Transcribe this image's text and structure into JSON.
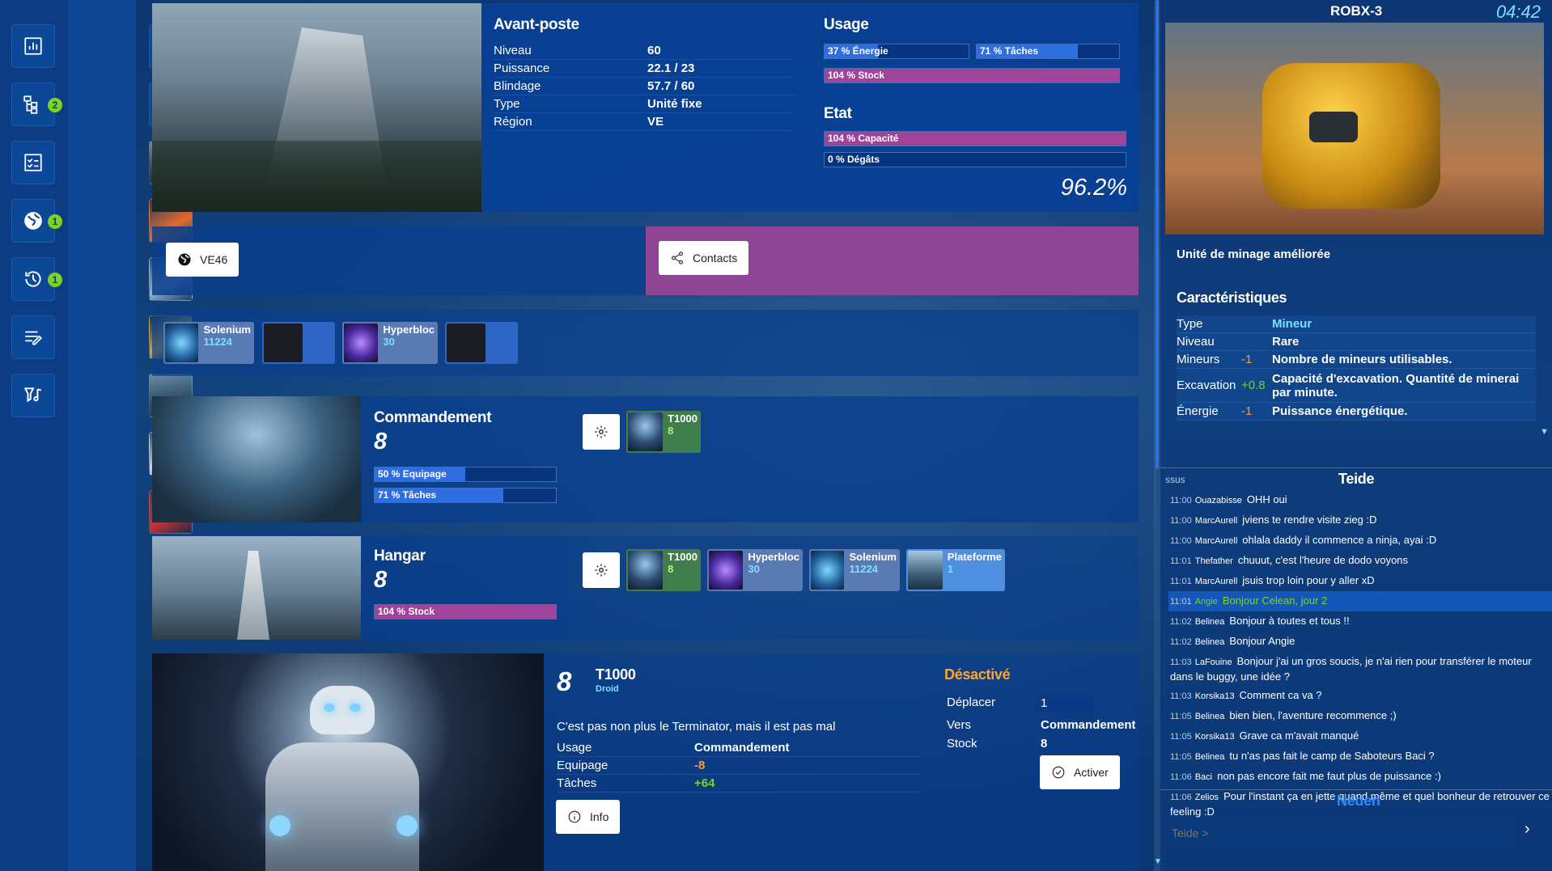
{
  "sidebar": {
    "icons": [
      "chart-icon",
      "hierarchy-icon",
      "checklist-icon",
      "globe-icon",
      "history-icon",
      "edit-list-icon",
      "filter-music-icon"
    ],
    "badges": {
      "hierarchy": "2",
      "globe": "1",
      "history": "1"
    }
  },
  "outpost": {
    "title": "Avant-poste",
    "stats": [
      {
        "label": "Niveau",
        "value": "60"
      },
      {
        "label": "Puissance",
        "value": "22.1 / 23"
      },
      {
        "label": "Blindage",
        "value": "57.7 / 60"
      },
      {
        "label": "Type",
        "value": "Unité fixe"
      },
      {
        "label": "Région",
        "value": "VE"
      }
    ],
    "usage_title": "Usage",
    "usage": [
      {
        "label": "37 % Énergie",
        "pct": 37
      },
      {
        "label": "71 % Tâches",
        "pct": 71
      },
      {
        "label": "104 % Stock",
        "pct": 100
      }
    ],
    "etat_title": "Etat",
    "etat": [
      {
        "label": "104 % Capacité",
        "pct": 100
      },
      {
        "label": "0 % Dégâts",
        "pct": 0
      }
    ],
    "score": "96.2%"
  },
  "location_button": "VE46",
  "contacts_button": "Contacts",
  "resources": [
    {
      "name": "Solenium",
      "count": "11224"
    },
    {
      "name": "",
      "count": ""
    },
    {
      "name": "Hyperbloc",
      "count": "30"
    },
    {
      "name": "",
      "count": ""
    }
  ],
  "command": {
    "title": "Commandement",
    "level": "8",
    "bars": [
      {
        "label": "50 % Equipage",
        "pct": 50
      },
      {
        "label": "71 % Tâches",
        "pct": 71
      }
    ],
    "unit": {
      "name": "T1000",
      "count": "8"
    }
  },
  "hangar": {
    "title": "Hangar",
    "level": "8",
    "bars": [
      {
        "label": "104 % Stock",
        "pct": 100
      }
    ],
    "items": [
      {
        "name": "T1000",
        "count": "8"
      },
      {
        "name": "Hyperbloc",
        "count": "30"
      },
      {
        "name": "Solenium",
        "count": "11224"
      },
      {
        "name": "Plateforme",
        "count": "1"
      }
    ]
  },
  "unit": {
    "level": "8",
    "name": "T1000",
    "type": "Droid",
    "desc": "C'est pas non plus le Terminator, mais il est pas mal",
    "stats": [
      {
        "label": "Usage",
        "value": "Commandement"
      },
      {
        "label": "Equipage",
        "value": "-8"
      },
      {
        "label": "Tâches",
        "value": "+64"
      }
    ],
    "info_button": "Info",
    "status": "Désactivé",
    "move_label": "Déplacer",
    "move_value": "1",
    "to_label": "Vers",
    "to_value": "Commandement",
    "stock_label": "Stock",
    "stock_value": "8",
    "activate_button": "Activer"
  },
  "robot": {
    "name": "ROBX-3",
    "time": "04:42",
    "subtitle": "Unité de minage améliorée",
    "section": "Caractéristiques",
    "rows": [
      {
        "label": "Type",
        "mod": "",
        "value": "Mineur"
      },
      {
        "label": "Niveau",
        "mod": "",
        "value": "Rare"
      },
      {
        "label": "Mineurs",
        "mod": "-1",
        "value": "Nombre de mineurs utilisables."
      },
      {
        "label": "Excavation",
        "mod": "+0.8",
        "value": "Capacité d'excavation. Quantité de minerai par minute."
      },
      {
        "label": "Énergie",
        "mod": "-1",
        "value": "Puissance énergétique."
      }
    ]
  },
  "chat": {
    "left_tab": "ssus",
    "title": "Teide",
    "messages": [
      {
        "time": "11:00",
        "user": "Ouazabisse",
        "text": "OHH oui"
      },
      {
        "time": "11:00",
        "user": "MarcAurell",
        "text": "jviens te rendre visite zieg :D"
      },
      {
        "time": "11:00",
        "user": "MarcAurell",
        "text": "ohlala daddy il commence a ninja, ayai :D"
      },
      {
        "time": "11:01",
        "user": "Thefather",
        "text": "chuuut, c'est l'heure de dodo voyons"
      },
      {
        "time": "11:01",
        "user": "MarcAurell",
        "text": "jsuis trop loin pour y aller xD"
      },
      {
        "time": "11:01",
        "user": "Angie",
        "text": "Bonjour Celean, jour 2"
      },
      {
        "time": "11:02",
        "user": "Belinea",
        "text": "Bonjour à toutes et tous !!"
      },
      {
        "time": "11:02",
        "user": "Belinea",
        "text": "Bonjour Angie"
      },
      {
        "time": "11:03",
        "user": "LaFouine",
        "text": "Bonjour j'ai un gros soucis, je n'ai rien pour transférer le moteur dans le buggy, une idée ?"
      },
      {
        "time": "11:03",
        "user": "Korsika13",
        "text": "Comment ca va ?"
      },
      {
        "time": "11:05",
        "user": "Belinea",
        "text": "bien bien, l'aventure recommence ;)"
      },
      {
        "time": "11:05",
        "user": "Korsika13",
        "text": "Grave ca m'avait manqué"
      },
      {
        "time": "11:05",
        "user": "Belinea",
        "text": "tu n'as pas fait le camp de Saboteurs Baci ?"
      },
      {
        "time": "11:06",
        "user": "Baci",
        "text": "non pas encore fait me faut plus de puissance :)"
      },
      {
        "time": "11:06",
        "user": "Zelios",
        "text": "Pour l'instant ça en jette quand même et quel bonheur de retrouver ce feeling :D"
      }
    ],
    "next_tab": "Neden",
    "input_placeholder": "Teide >"
  }
}
